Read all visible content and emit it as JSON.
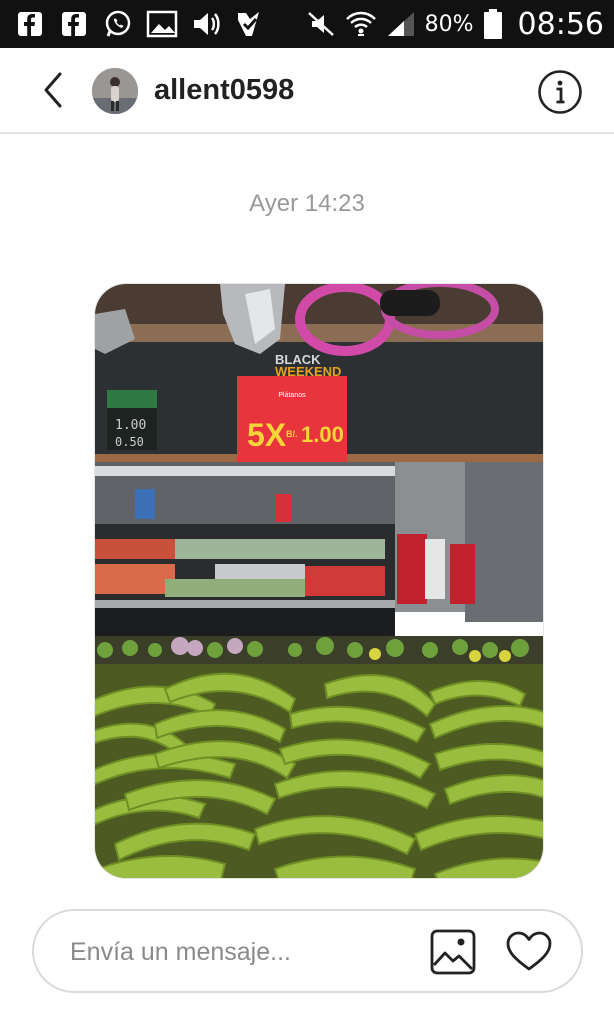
{
  "status_bar": {
    "icons": [
      "facebook-icon",
      "facebook-icon",
      "whatsapp-icon",
      "image-icon",
      "volume-icon",
      "check-icon",
      "mute-icon",
      "wifi-icon",
      "signal-icon",
      "battery-icon"
    ],
    "battery": "80%",
    "time": "08:56"
  },
  "header": {
    "username": "allent0598",
    "back_icon": "chevron-left-icon",
    "info_icon": "info-icon"
  },
  "conversation": {
    "timestamp": "Ayer 14:23",
    "photo": {
      "banner_text": "BLACK WEEKEND",
      "sign": {
        "product": "Plátanos",
        "offer": "5X",
        "currency": "B/.",
        "price": "1.00"
      },
      "board_price_1": "1.00",
      "board_price_2": "0.50"
    }
  },
  "composer": {
    "placeholder": "Envía un mensaje...",
    "value": ""
  },
  "colors": {
    "sign_red": "#e8343c",
    "sign_yellow": "#f7d43a",
    "plantain_green": "#9bbd3f"
  }
}
